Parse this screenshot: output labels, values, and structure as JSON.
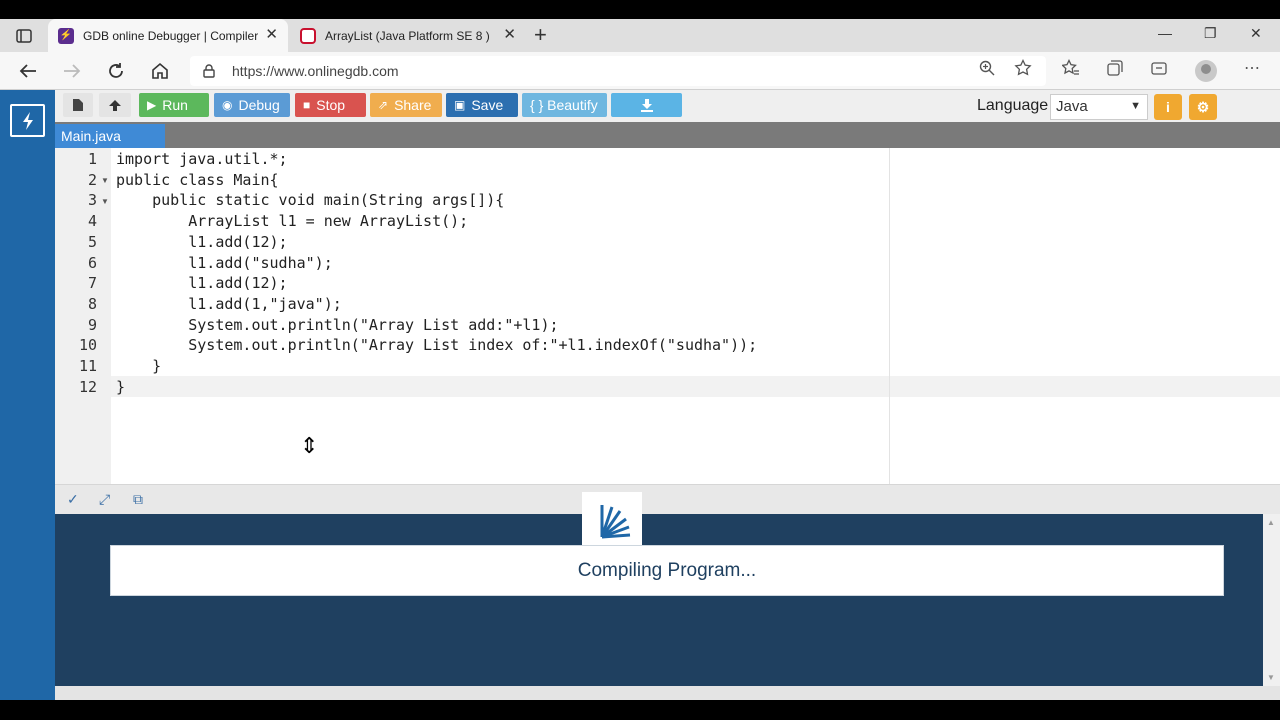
{
  "browser": {
    "tabs": [
      {
        "title": "GDB online Debugger | Compiler",
        "active": true,
        "favicon_color": "#5b2d8e"
      },
      {
        "title": "ArrayList (Java Platform SE 8 )",
        "active": false,
        "favicon_color": "#c8102e"
      }
    ],
    "url": "https://www.onlinegdb.com"
  },
  "toolbar": {
    "run": "Run",
    "debug": "Debug",
    "stop": "Stop",
    "share": "Share",
    "save": "Save",
    "beautify": "{ } Beautify",
    "language_label": "Language",
    "language_value": "Java",
    "colors": {
      "run": "#5cb85c",
      "debug": "#5b9bd5",
      "stop": "#d9534f",
      "share": "#f0ad4e",
      "save": "#2c6fb0",
      "beautify": "#6fb7e0",
      "download": "#5bb4e5"
    }
  },
  "file_tab": "Main.java",
  "code": {
    "lines": [
      "import java.util.*;",
      "public class Main{",
      "    public static void main(String args[]){",
      "        ArrayList l1 = new ArrayList();",
      "        l1.add(12);",
      "        l1.add(\"sudha\");",
      "        l1.add(12);",
      "        l1.add(1,\"java\");",
      "        System.out.println(\"Array List add:\"+l1);",
      "        System.out.println(\"Array List index of:\"+l1.indexOf(\"sudha\"));",
      "    }",
      "}"
    ],
    "line_numbers": [
      "1",
      "2",
      "3",
      "4",
      "5",
      "6",
      "7",
      "8",
      "9",
      "10",
      "11",
      "12"
    ]
  },
  "console": {
    "status": "Compiling Program..."
  }
}
